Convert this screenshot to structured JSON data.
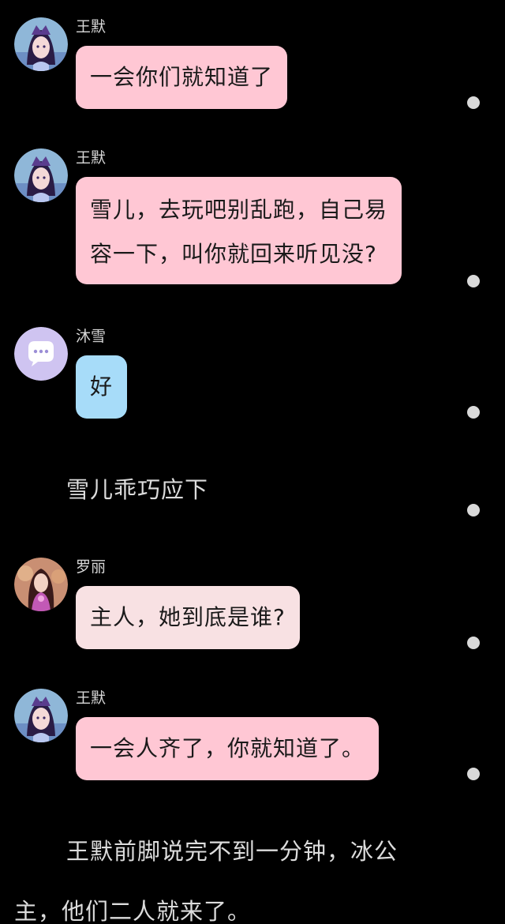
{
  "colors": {
    "background": "#000000",
    "bubble_pink": "#ffc7d4",
    "bubble_blue": "#a7dcf9",
    "bubble_peach": "#f8e1e3",
    "dot": "#d9d9d9"
  },
  "messages": [
    {
      "sender": "王默",
      "text": "一会你们就知道了",
      "avatar": "wangmo-avatar"
    },
    {
      "sender": "王默",
      "line1": "雪儿，去玩吧别乱跑，自己易",
      "line2": "容一下，叫你就回来听见没?",
      "avatar": "wangmo-avatar"
    },
    {
      "sender": "沐雪",
      "text": "好",
      "avatar": "chat-bubble-avatar"
    },
    {
      "sender": "罗丽",
      "text": "主人，她到底是谁?",
      "avatar": "luoli-avatar"
    },
    {
      "sender": "王默",
      "text": "一会人齐了，你就知道了。",
      "avatar": "wangmo-avatar"
    }
  ],
  "narration": {
    "n1": "雪儿乖巧应下",
    "n2_line1": "王默前脚说完不到一分钟，冰公",
    "n2_line2": "主，他们二人就来了。"
  }
}
